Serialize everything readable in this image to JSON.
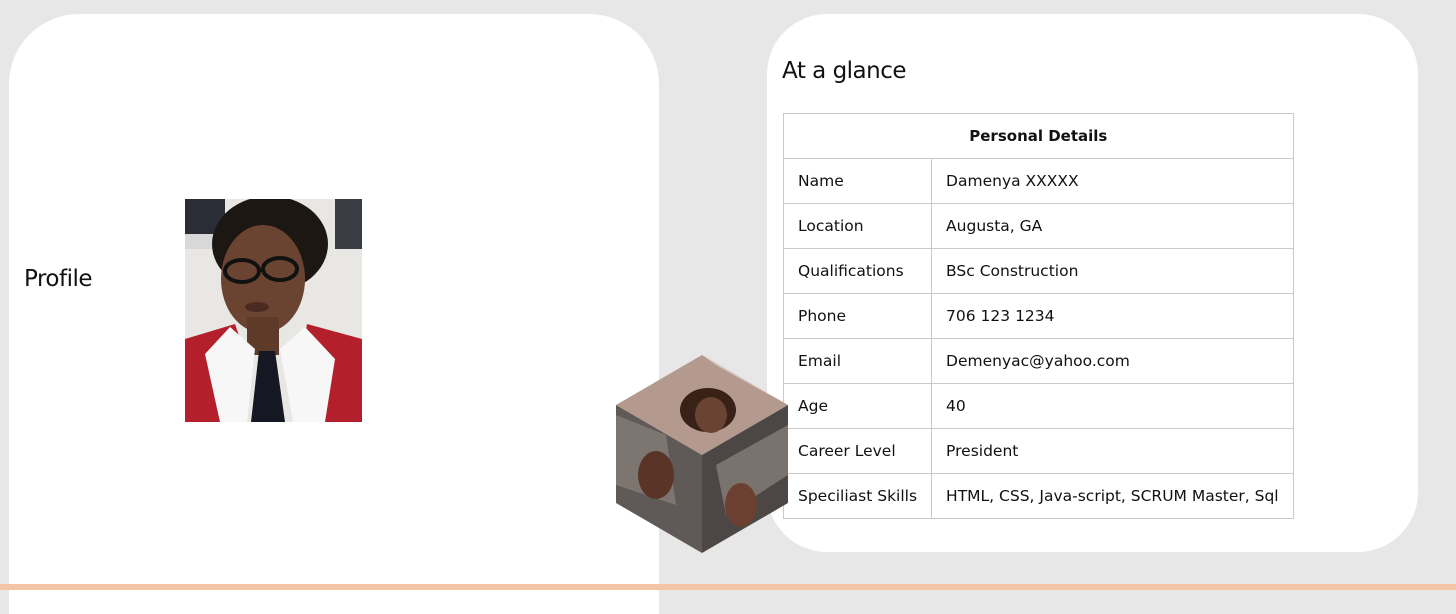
{
  "profile": {
    "heading": "Profile"
  },
  "glance": {
    "heading": "At a glance",
    "table_title": "Personal Details",
    "rows": [
      {
        "label": "Name",
        "value": "Damenya XXXXX"
      },
      {
        "label": "Location",
        "value": "Augusta, GA"
      },
      {
        "label": "Qualifications",
        "value": "BSc Construction"
      },
      {
        "label": "Phone",
        "value": "706 123 1234"
      },
      {
        "label": "Email",
        "value": "Demenyac@yahoo.com"
      },
      {
        "label": "Age",
        "value": "40"
      },
      {
        "label": "Career Level",
        "value": "President"
      },
      {
        "label": "Speciliast Skills",
        "value": "HTML, CSS, Java-script, SCRUM Master, Sql"
      }
    ]
  },
  "colors": {
    "page_background": "#e6e7e6",
    "card_background": "#ffffff",
    "table_border": "#c9c9c9",
    "bottom_accent": "#f1c5a6"
  }
}
